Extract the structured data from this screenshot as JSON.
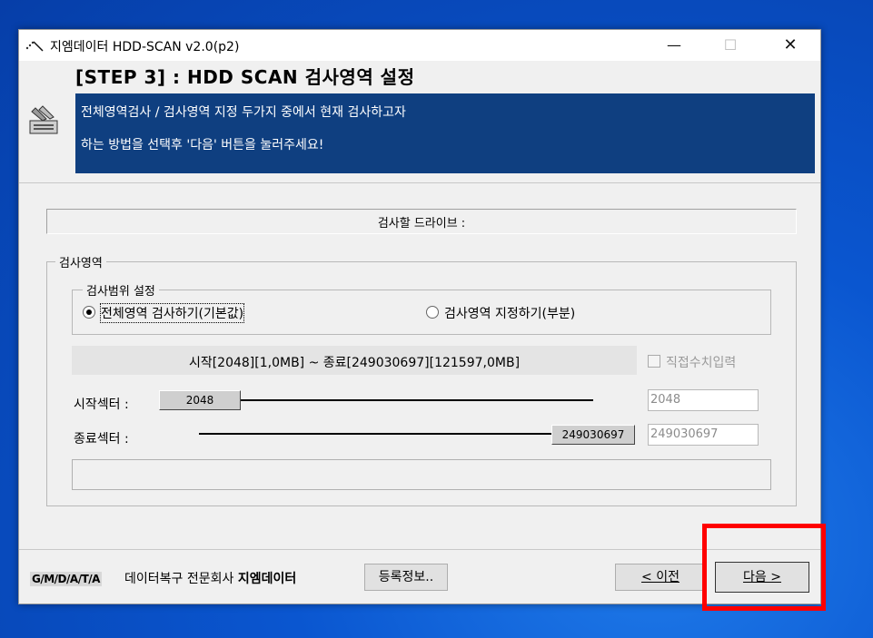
{
  "window": {
    "title": "지엠데이터 HDD-SCAN v2.0(p2)",
    "controls": {
      "minimize": "—",
      "maximize": "☐",
      "close": "✕"
    }
  },
  "header": {
    "step_title": "[STEP 3] : HDD SCAN 검사영역 설정",
    "banner_line1": "전체영역검사 / 검사영역 지정 두가지 중에서 현재 검사하고자",
    "banner_line2": "하는 방법을 선택후 '다음' 버튼을 눌러주세요!"
  },
  "drive": {
    "label": "검사할 드라이브 :"
  },
  "scan_area": {
    "group_title": "검사영역",
    "range_group_title": "검사범위 설정",
    "option_full": "전체영역 검사하기(기본값)",
    "option_partial": "검사영역 지정하기(부분)",
    "selected": "full",
    "range_info": "시작[2048][1,0MB] ~ 종료[249030697][121597,0MB]",
    "manual_input_label": "직접수치입력",
    "manual_input_checked": false,
    "start_label": "시작섹터 :",
    "end_label": "종료섹터 :",
    "start_value": "2048",
    "end_value": "249030697",
    "start_field": "2048",
    "end_field": "249030697"
  },
  "footer": {
    "logo": "G/M/D/A/T/A",
    "company_prefix": "데이터복구 전문회사 ",
    "company_name": "지엠데이터",
    "register_button": "등록정보..",
    "prev_button": "< 이전",
    "next_button": "다음 >"
  },
  "colors": {
    "banner": "#0f3f80",
    "highlight": "#ff0000",
    "desktop": "#0a4fc4"
  }
}
